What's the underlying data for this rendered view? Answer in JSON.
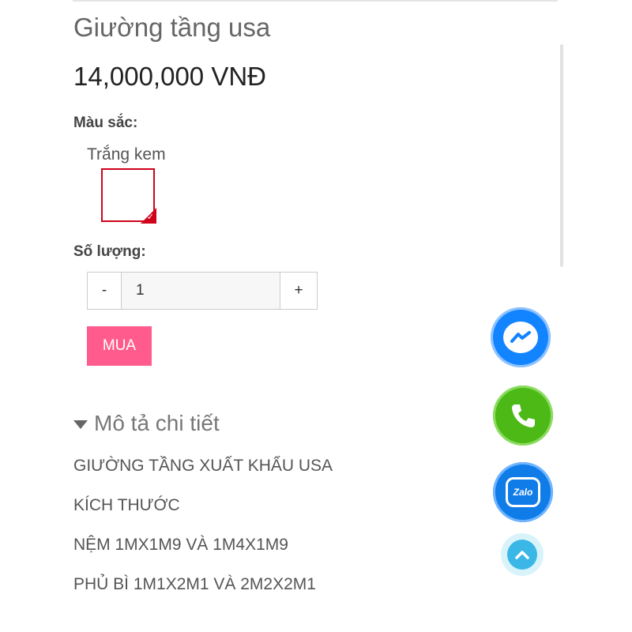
{
  "product": {
    "title": "Giường tầng usa",
    "price": "14,000,000 VNĐ"
  },
  "options": {
    "color_label": "Màu sắc:",
    "color_value": "Trắng kem",
    "color_selected": true
  },
  "quantity": {
    "label": "Số lượng:",
    "minus": "-",
    "value": "1",
    "plus": "+"
  },
  "actions": {
    "buy_label": "MUA",
    "buy_color": "#ff5c8d"
  },
  "description": {
    "header": "Mô tả chi tiết",
    "lines": [
      "GIƯỜNG TẦNG XUẤT KHẨU USA",
      "KÍCH THƯỚC",
      "NỆM 1MX1M9 VÀ 1M4X1M9",
      "PHỦ BÌ 1M1X2M1 VÀ 2M2X2M1"
    ]
  },
  "floating_contacts": {
    "messenger_icon": "messenger-icon",
    "phone_icon": "phone-icon",
    "zalo_icon": "zalo-icon",
    "zalo_text": "Zalo",
    "back_to_top_icon": "chevron-up-icon"
  }
}
